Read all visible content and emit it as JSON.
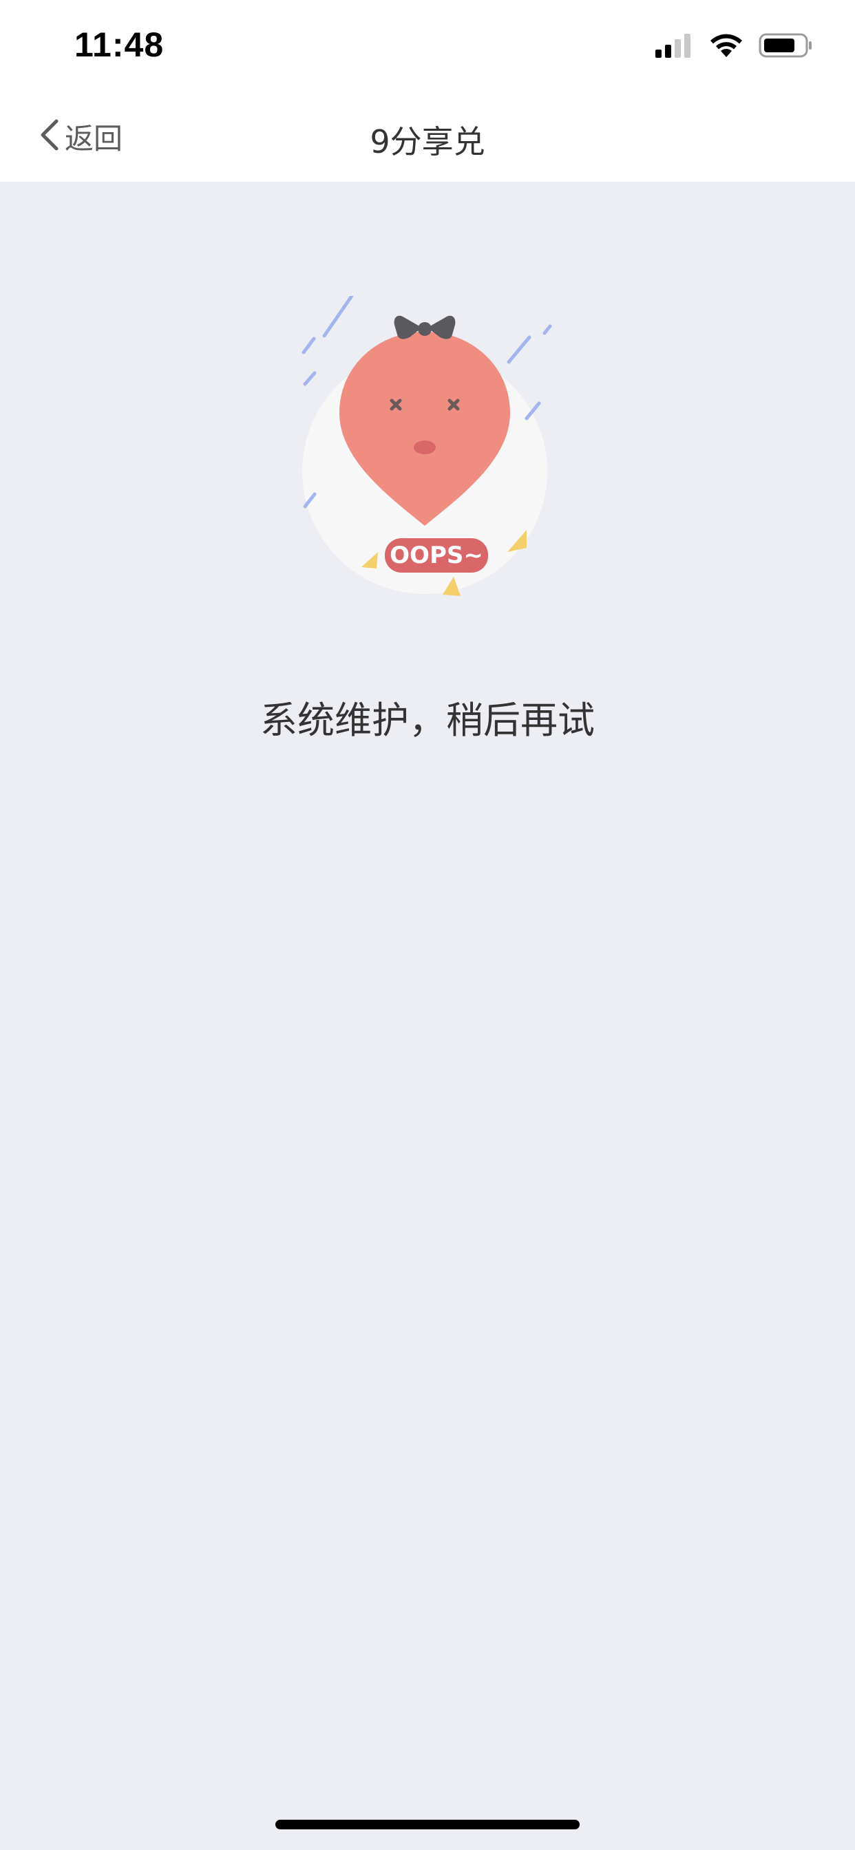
{
  "status_bar": {
    "time": "11:48",
    "icons": [
      "signal-icon",
      "wifi-icon",
      "battery-icon"
    ]
  },
  "nav": {
    "back_label": "返回",
    "back_icon": "chevron-left-icon",
    "title": "9分享兑"
  },
  "illustration": {
    "badge_text": "OOPS~",
    "icon": "sad-balloon-illustration",
    "colors": {
      "balloon": "#ef8d80",
      "circle": "#f7f7f8",
      "rain": "#a3b4ee",
      "confetti": "#f5cf6b",
      "badge": "#d9676a"
    }
  },
  "message": "系统维护，稍后再试",
  "colors": {
    "background": "#edeef3",
    "header": "#ffffff",
    "text": "#333333"
  }
}
